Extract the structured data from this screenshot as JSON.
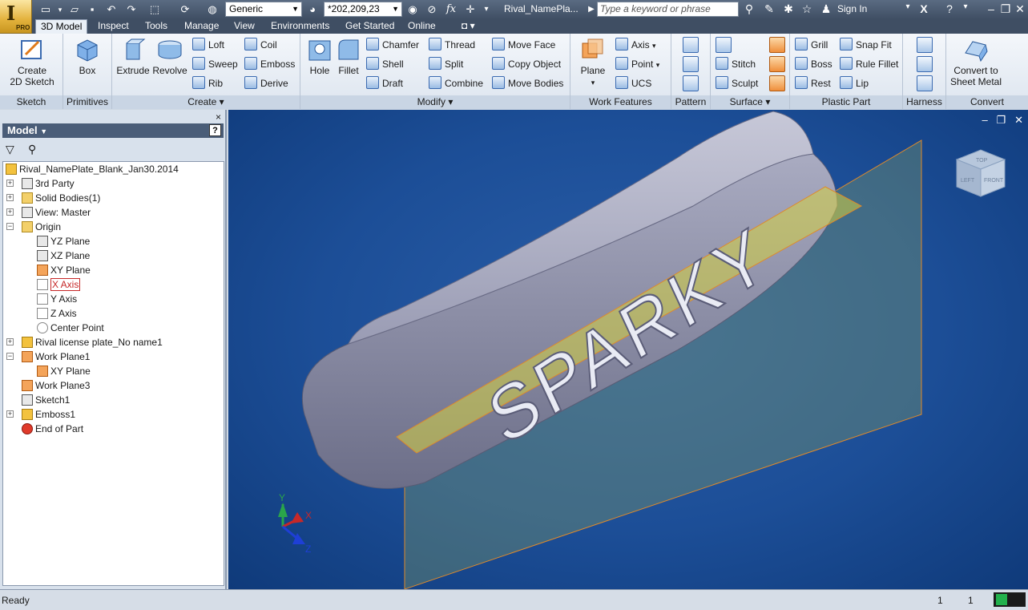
{
  "app": {
    "logo_letter": "I",
    "edition": "PRO",
    "document_title": "Rival_NamePla..."
  },
  "quick_access": {
    "appearance": "Generic",
    "color_value": "*202,209,23",
    "fx_label": "fx"
  },
  "title_bar": {
    "search_placeholder": "Type a keyword or phrase",
    "sign_in": "Sign In"
  },
  "tabs": [
    "3D Model",
    "Inspect",
    "Tools",
    "Manage",
    "View",
    "Environments",
    "Get Started",
    "Online"
  ],
  "ribbon": {
    "sketch": {
      "panel": "Sketch",
      "create": "Create\n2D Sketch"
    },
    "primitives": {
      "panel": "Primitives",
      "box": "Box"
    },
    "create": {
      "panel": "Create",
      "extrude": "Extrude",
      "revolve": "Revolve",
      "loft": "Loft",
      "sweep": "Sweep",
      "rib": "Rib",
      "coil": "Coil",
      "emboss": "Emboss",
      "derive": "Derive"
    },
    "modify": {
      "panel": "Modify",
      "hole": "Hole",
      "fillet": "Fillet",
      "chamfer": "Chamfer",
      "shell": "Shell",
      "draft": "Draft",
      "thread": "Thread",
      "split": "Split",
      "combine": "Combine",
      "move_face": "Move Face",
      "copy_object": "Copy Object",
      "move_bodies": "Move Bodies"
    },
    "work_features": {
      "panel": "Work Features",
      "plane": "Plane",
      "axis": "Axis",
      "point": "Point",
      "ucs": "UCS"
    },
    "pattern": {
      "panel": "Pattern"
    },
    "surface": {
      "panel": "Surface",
      "stitch": "Stitch",
      "sculpt": "Sculpt"
    },
    "plastic_part": {
      "panel": "Plastic Part",
      "grill": "Grill",
      "boss": "Boss",
      "rest": "Rest",
      "snap_fit": "Snap Fit",
      "rule_fillet": "Rule Fillet",
      "lip": "Lip"
    },
    "harness": {
      "panel": "Harness"
    },
    "convert": {
      "panel": "Convert",
      "sheet_metal": "Convert to\nSheet Metal"
    }
  },
  "browser": {
    "title": "Model",
    "help": "?",
    "close": "×",
    "tree": [
      {
        "label": "Rival_NamePlate_Blank_Jan30.2014",
        "icon": "part-icon"
      },
      {
        "label": "3rd Party",
        "icon": "third-party-icon"
      },
      {
        "label": "Solid Bodies(1)",
        "icon": "solid-bodies-icon"
      },
      {
        "label": "View: Master",
        "icon": "view-icon"
      },
      {
        "label": "Origin",
        "icon": "folder-icon"
      },
      {
        "label": "YZ Plane",
        "icon": "plane-icon"
      },
      {
        "label": "XZ Plane",
        "icon": "plane-icon"
      },
      {
        "label": "XY Plane",
        "icon": "plane-icon"
      },
      {
        "label": "X Axis",
        "icon": "axis-icon"
      },
      {
        "label": "Y Axis",
        "icon": "axis-icon"
      },
      {
        "label": "Z Axis",
        "icon": "axis-icon"
      },
      {
        "label": "Center Point",
        "icon": "point-icon"
      },
      {
        "label": "Rival license plate_No name1",
        "icon": "derived-part-icon"
      },
      {
        "label": "Work Plane1",
        "icon": "work-plane-icon"
      },
      {
        "label": "XY Plane",
        "icon": "plane-icon"
      },
      {
        "label": "Work Plane3",
        "icon": "work-plane-icon"
      },
      {
        "label": "Sketch1",
        "icon": "sketch-icon"
      },
      {
        "label": "Emboss1",
        "icon": "emboss-icon"
      },
      {
        "label": "End of Part",
        "icon": "end-of-part-icon"
      }
    ]
  },
  "viewport": {
    "model_text": "SPARKY",
    "viewcube": {
      "top": "TOP",
      "left": "LEFT",
      "front": "FRONT"
    },
    "triad": {
      "x": "X",
      "y": "Y",
      "z": "Z"
    }
  },
  "status": {
    "text": "Ready",
    "count1": "1",
    "count2": "1"
  },
  "colors": {
    "accent": "#3f4e63",
    "viewport": "#1c4e97",
    "plane": "#c8c84a"
  }
}
